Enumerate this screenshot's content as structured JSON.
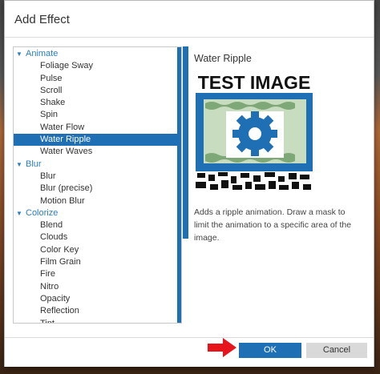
{
  "dialog": {
    "title": "Add Effect"
  },
  "tree": {
    "categories": [
      {
        "label": "Animate",
        "expanded": true,
        "items": [
          "Foliage Sway",
          "Pulse",
          "Scroll",
          "Shake",
          "Spin",
          "Water Flow",
          "Water Ripple",
          "Water Waves"
        ]
      },
      {
        "label": "Blur",
        "expanded": true,
        "items": [
          "Blur",
          "Blur (precise)",
          "Motion Blur"
        ]
      },
      {
        "label": "Colorize",
        "expanded": true,
        "items": [
          "Blend",
          "Clouds",
          "Color Key",
          "Film Grain",
          "Fire",
          "Nitro",
          "Opacity",
          "Reflection",
          "Tint"
        ]
      }
    ],
    "selected": "Water Ripple"
  },
  "preview": {
    "title": "Water Ripple",
    "image_text": "TEST IMAGE",
    "description": "Adds a ripple animation. Draw a mask to limit the animation to a specific area of the image."
  },
  "buttons": {
    "ok": "OK",
    "cancel": "Cancel"
  },
  "colors": {
    "accent": "#1f6fb5",
    "category_text": "#2a7ec2",
    "arrow_indicator": "#e8141c"
  }
}
